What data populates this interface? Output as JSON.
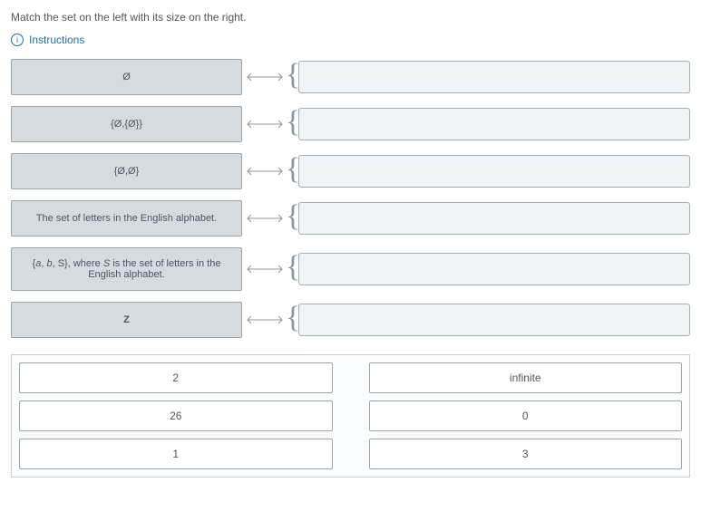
{
  "prompt": "Match the set on the left with its size on the right.",
  "instructions_label": "Instructions",
  "left_items": [
    "Ø",
    "{Ø,{Ø}}",
    "{Ø,Ø}",
    "The set of letters in the English alphabet.",
    "{a, b, S}, where S is the set of letters in the English alphabet.",
    "Z"
  ],
  "answer_bank": [
    "2",
    "infinite",
    "26",
    "0",
    "1",
    "3"
  ]
}
